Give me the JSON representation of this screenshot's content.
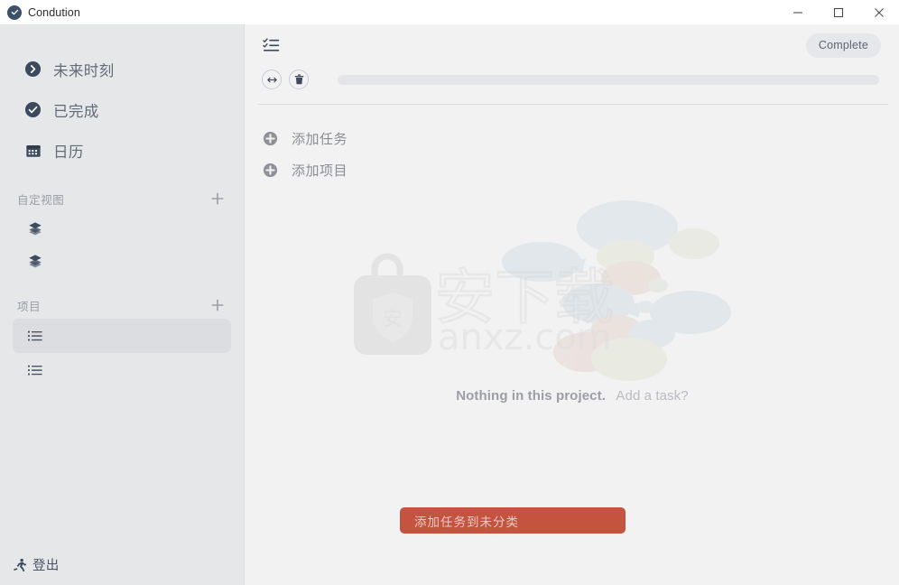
{
  "window": {
    "app_icon": "check-circle-icon",
    "title": "Condution",
    "controls": [
      {
        "name": "minimize",
        "glyph": "minimize-icon"
      },
      {
        "name": "maximize",
        "glyph": "maximize-icon"
      },
      {
        "name": "close",
        "glyph": "close-icon"
      }
    ]
  },
  "sidebar": {
    "nav": [
      {
        "icon": "chevron-right-circle-icon",
        "label": "未来时刻"
      },
      {
        "icon": "check-circle-icon",
        "label": "已完成"
      },
      {
        "icon": "calendar-icon",
        "label": "日历"
      }
    ],
    "custom_views": {
      "title": "自定视图",
      "add_label": "plus-icon",
      "items": [
        {
          "icon": "layers-icon",
          "label": ""
        },
        {
          "icon": "layers-icon",
          "label": ""
        }
      ]
    },
    "projects": {
      "title": "项目",
      "add_label": "plus-icon",
      "items": [
        {
          "icon": "list-icon",
          "label": "",
          "selected": true
        },
        {
          "icon": "list-icon",
          "label": "",
          "selected": false
        }
      ]
    },
    "logout": {
      "icon": "running-person-icon",
      "label": "登出"
    }
  },
  "main": {
    "toolbar": {
      "list_icon": "tasks-checklist-icon",
      "complete_label": "Complete",
      "expand_icon": "arrows-left-right-icon",
      "delete_icon": "trash-icon",
      "name_field_value": "",
      "name_field_placeholder": ""
    },
    "actions": [
      {
        "icon": "plus-circle-icon",
        "label": "添加任务"
      },
      {
        "icon": "plus-circle-icon",
        "label": "添加项目"
      }
    ],
    "empty_state": {
      "primary": "Nothing in this project.",
      "secondary": "Add a task?"
    },
    "cta": {
      "label": "添加任务到未分类",
      "color": "#c4533f"
    }
  },
  "watermark": {
    "text": "anxz.com",
    "logo_char": "安"
  },
  "colors": {
    "sidebar_bg": "#e6e7e9",
    "main_bg": "#f2f2f3",
    "titlebar_bg": "#ffffff",
    "accent_red": "#c4533f",
    "icon_dark": "#3c4a5e",
    "text_muted": "#8b8e95"
  }
}
